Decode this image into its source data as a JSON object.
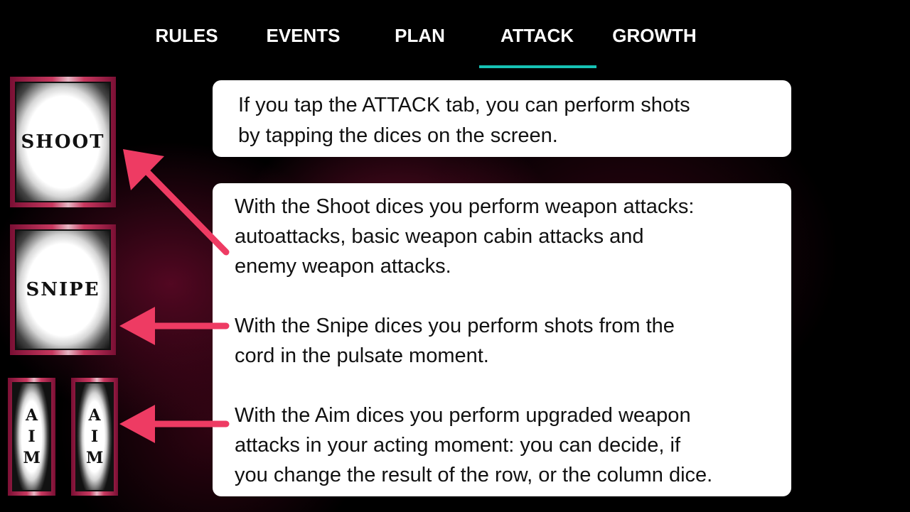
{
  "tabs": [
    {
      "label": "RULES"
    },
    {
      "label": "EVENTS"
    },
    {
      "label": "PLAN"
    },
    {
      "label": "ATTACK",
      "active": true
    },
    {
      "label": "GROWTH"
    }
  ],
  "accent_color": "#16c2b4",
  "arrow_color": "#ee3b63",
  "cards": {
    "shoot": "SHOOT",
    "snipe": "SNIPE",
    "aim": "AIM"
  },
  "intro_text": {
    "line1": "If you tap the ATTACK tab, you can perform shots",
    "line2": "by tapping the dices on the screen."
  },
  "details": {
    "shoot": [
      "With the Shoot dices you perform weapon attacks:",
      "autoattacks, basic weapon cabin attacks and",
      "enemy weapon attacks."
    ],
    "snipe": [
      "With the Snipe dices you perform shots from the",
      "cord in the pulsate moment."
    ],
    "aim": [
      "With the Aim dices you perform upgraded weapon",
      "attacks in your acting moment: you can decide, if",
      "you change the result of the row, or the column dice."
    ]
  }
}
